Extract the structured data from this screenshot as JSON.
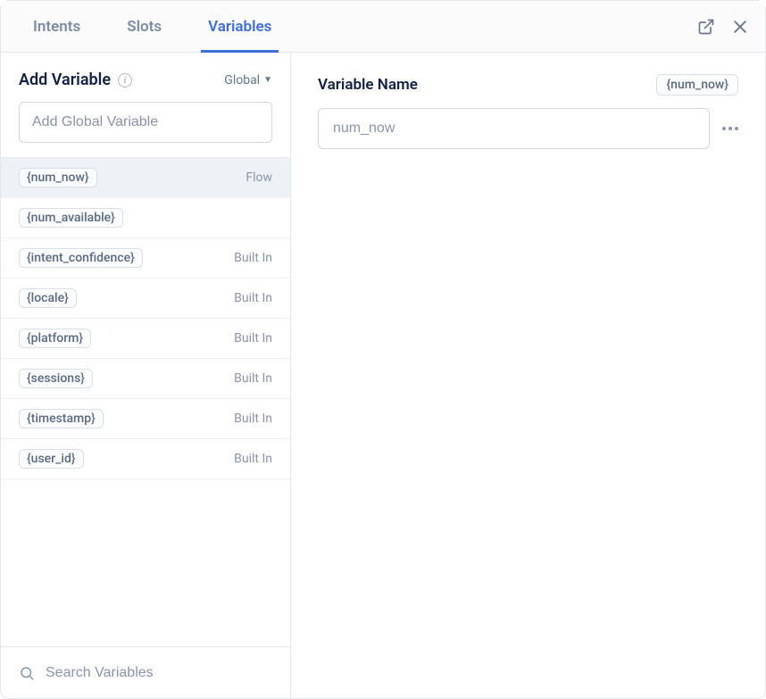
{
  "tabs": {
    "intents": "Intents",
    "slots": "Slots",
    "variables": "Variables"
  },
  "sidebar": {
    "add_title": "Add Variable",
    "scope_label": "Global",
    "add_placeholder": "Add Global Variable",
    "search_placeholder": "Search Variables",
    "items": [
      {
        "name": "{num_now}",
        "type": "Flow",
        "selected": true
      },
      {
        "name": "{num_available}",
        "type": "",
        "selected": false
      },
      {
        "name": "{intent_confidence}",
        "type": "Built In",
        "selected": false
      },
      {
        "name": "{locale}",
        "type": "Built In",
        "selected": false
      },
      {
        "name": "{platform}",
        "type": "Built In",
        "selected": false
      },
      {
        "name": "{sessions}",
        "type": "Built In",
        "selected": false
      },
      {
        "name": "{timestamp}",
        "type": "Built In",
        "selected": false
      },
      {
        "name": "{user_id}",
        "type": "Built In",
        "selected": false
      }
    ]
  },
  "main": {
    "title": "Variable Name",
    "token": "{num_now}",
    "name_value": "num_now"
  }
}
